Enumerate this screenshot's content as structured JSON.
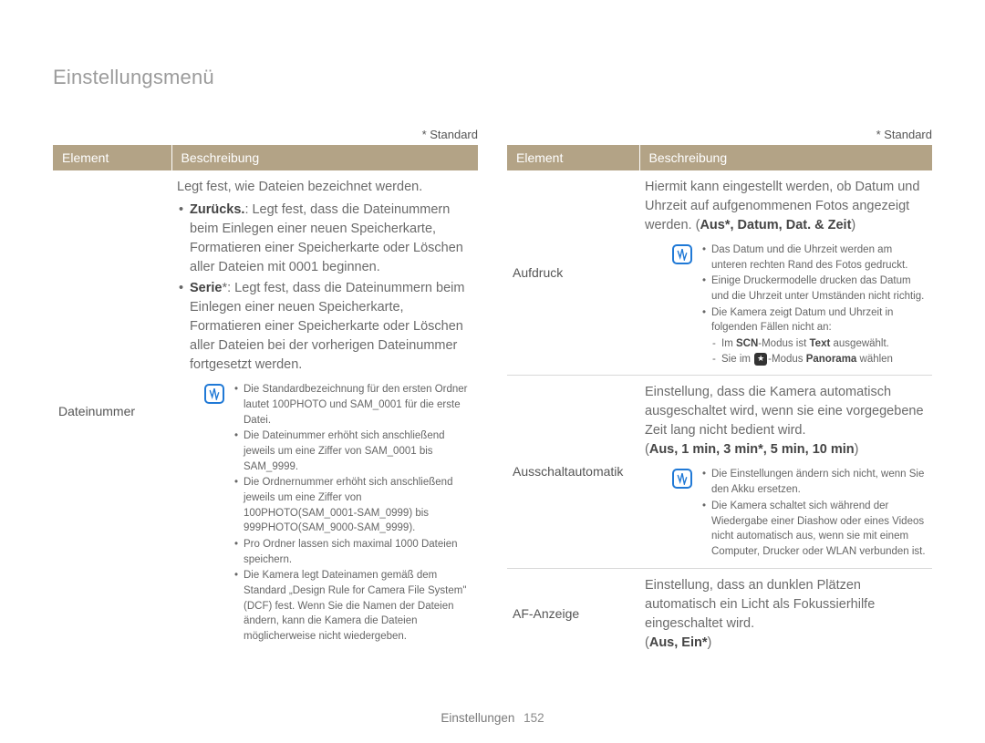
{
  "page_title": "Einstellungsmenü",
  "standard_note": "* Standard",
  "headers": {
    "element": "Element",
    "description": "Beschreibung"
  },
  "left": {
    "row1": {
      "element": "Dateinummer",
      "intro": "Legt fest, wie Dateien bezeichnet werden.",
      "b1_label": "Zurücks.",
      "b1_text": ": Legt fest, dass die Dateinummern beim Einlegen einer neuen Speicherkarte, Formatieren einer Speicherkarte oder Löschen aller Dateien mit 0001 beginnen.",
      "b2_label": "Serie",
      "b2_text": "*: Legt fest, dass die Dateinummern beim Einlegen einer neuen Speicherkarte, Formatieren einer Speicherkarte oder Löschen aller Dateien bei der vorherigen Dateinummer fortgesetzt werden.",
      "n1": "Die Standardbezeichnung für den ersten Ordner lautet 100PHOTO und SAM_0001 für die erste Datei.",
      "n2": "Die Dateinummer erhöht sich anschließend jeweils um eine Ziffer von SAM_0001 bis SAM_9999.",
      "n3": "Die Ordnernummer erhöht sich anschließend jeweils um eine Ziffer von 100PHOTO(SAM_0001-SAM_0999) bis 999PHOTO(SAM_9000-SAM_9999).",
      "n4": "Pro Ordner lassen sich maximal 1000 Dateien speichern.",
      "n5": "Die Kamera legt Dateinamen gemäß dem Standard „Design Rule for Camera File System\" (DCF) fest. Wenn Sie die Namen der Dateien ändern, kann die Kamera die Dateien möglicherweise nicht wiedergeben."
    }
  },
  "right": {
    "row1": {
      "element": "Aufdruck",
      "intro": "Hiermit kann eingestellt werden, ob Datum und Uhrzeit auf aufgenommenen Fotos angezeigt werden. (",
      "options": "Aus*, Datum, Dat. & Zeit",
      "close": ")",
      "n1": "Das Datum und die Uhrzeit werden am unteren rechten Rand des Fotos gedruckt.",
      "n2": "Einige Druckermodelle drucken das Datum und die Uhrzeit unter Umständen nicht richtig.",
      "n3": "Die Kamera zeigt Datum und Uhrzeit in folgenden Fällen nicht an:",
      "n3a_pre": "Im ",
      "n3a_scn": "SCN",
      "n3a_post": "-Modus ist ",
      "n3a_text": "Text",
      "n3a_end": " ausgewählt.",
      "n3b_pre": "Sie im ",
      "n3b_mid": "-Modus ",
      "n3b_pan": "Panorama",
      "n3b_end": " wählen"
    },
    "row2": {
      "element": "Ausschaltautomatik",
      "intro": "Einstellung, dass die Kamera automatisch ausgeschaltet wird, wenn sie eine vorgegebene Zeit lang nicht bedient wird.",
      "options": "Aus, 1 min, 3 min*, 5 min, 10 min",
      "n1": "Die Einstellungen ändern sich nicht, wenn Sie den Akku ersetzen.",
      "n2": "Die Kamera schaltet sich während der Wiedergabe einer Diashow oder eines Videos nicht automatisch aus, wenn sie mit einem Computer, Drucker oder WLAN verbunden ist."
    },
    "row3": {
      "element": "AF-Anzeige",
      "intro": "Einstellung, dass an dunklen Plätzen automatisch ein Licht als Fokussierhilfe eingeschaltet wird.",
      "options": "Aus, Ein*"
    }
  },
  "footer": {
    "section": "Einstellungen",
    "page": "152"
  }
}
